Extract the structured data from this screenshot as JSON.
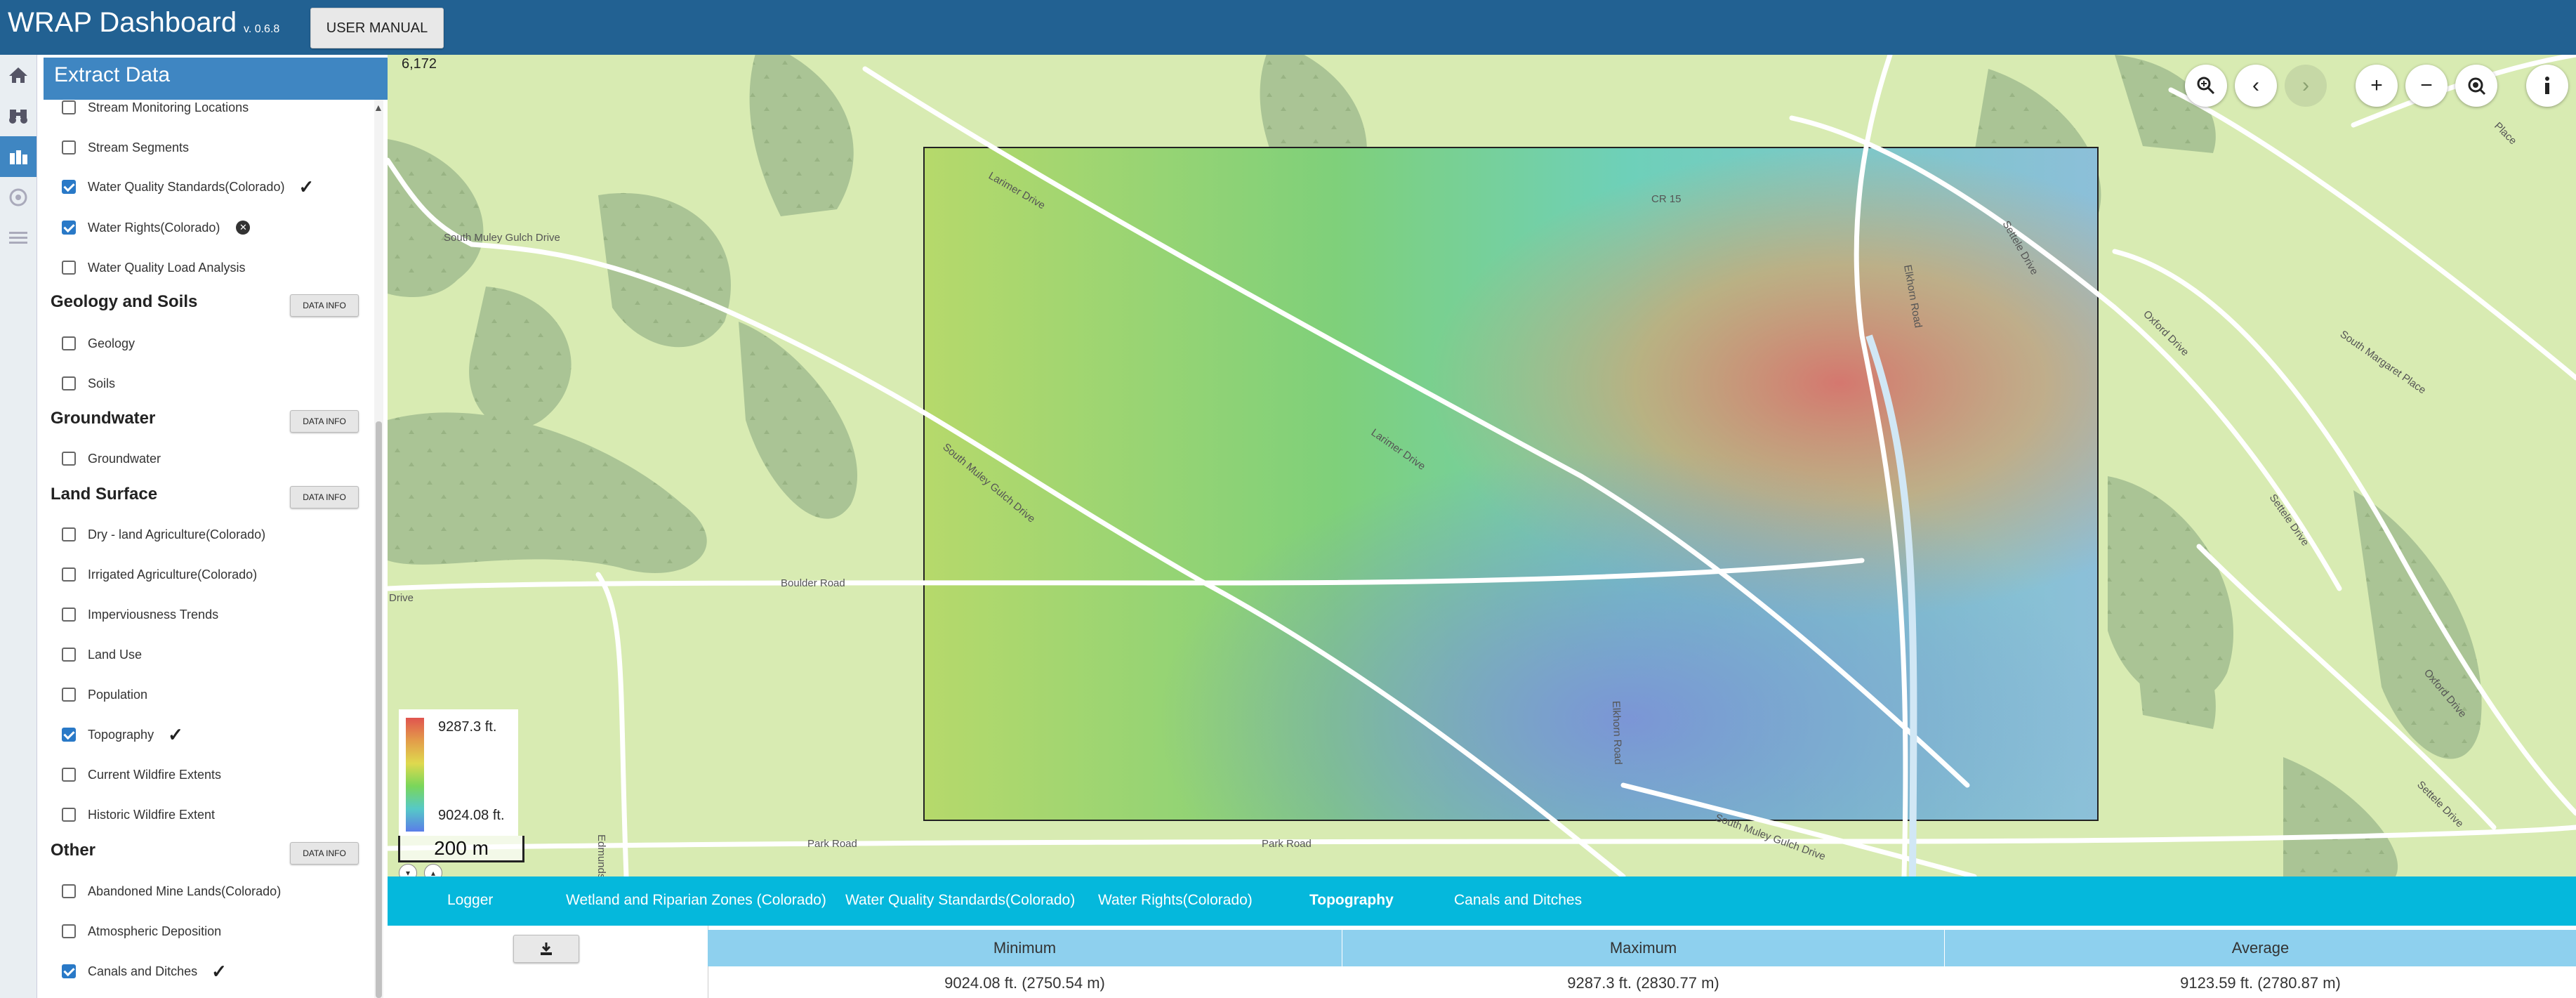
{
  "header": {
    "app_title": "WRAP Dashboard",
    "version": "v. 0.6.8",
    "manual_button": "USER MANUAL"
  },
  "rail": {
    "icons": [
      "home-icon",
      "binoculars-icon",
      "extract-data-icon",
      "target-icon",
      "list-icon"
    ],
    "active": "extract-data-icon"
  },
  "panel": {
    "title": "Extract Data",
    "items_top": [
      {
        "label": "Stream Monitoring Locations",
        "checked": false
      },
      {
        "label": "Stream Segments",
        "checked": false
      },
      {
        "label": "Water Quality Standards(Colorado)",
        "checked": true,
        "status": "done"
      },
      {
        "label": "Water Rights(Colorado)",
        "checked": true,
        "status": "error"
      },
      {
        "label": "Water Quality Load Analysis",
        "checked": false
      }
    ],
    "sections": [
      {
        "title": "Geology and Soils",
        "info": "DATA INFO",
        "items": [
          {
            "label": "Geology",
            "checked": false
          },
          {
            "label": "Soils",
            "checked": false
          }
        ]
      },
      {
        "title": "Groundwater",
        "info": "DATA INFO",
        "items": [
          {
            "label": "Groundwater",
            "checked": false
          }
        ]
      },
      {
        "title": "Land Surface",
        "info": "DATA INFO",
        "items": [
          {
            "label": "Dry - land Agriculture(Colorado)",
            "checked": false
          },
          {
            "label": "Irrigated Agriculture(Colorado)",
            "checked": false
          },
          {
            "label": "Imperviousness Trends",
            "checked": false
          },
          {
            "label": "Land Use",
            "checked": false
          },
          {
            "label": "Population",
            "checked": false
          },
          {
            "label": "Topography",
            "checked": true,
            "status": "done"
          },
          {
            "label": "Current Wildfire Extents",
            "checked": false
          },
          {
            "label": "Historic Wildfire Extent",
            "checked": false
          }
        ]
      },
      {
        "title": "Other",
        "info": "DATA INFO",
        "items": [
          {
            "label": "Abandoned Mine Lands(Colorado)",
            "checked": false
          },
          {
            "label": "Atmospheric Deposition",
            "checked": false
          },
          {
            "label": "Canals and Ditches",
            "checked": true,
            "status": "done"
          }
        ]
      }
    ]
  },
  "map": {
    "coord_readout": "6,172",
    "road_labels": [
      "Larimer Drive",
      "South Muley Gulch Drive",
      "CR 15",
      "Elkhorn Road",
      "Settele Drive",
      "Oxford Drive",
      "South Margaret Place",
      "Boulder Road",
      "Park Road",
      "Edmunds Drive",
      "Drive",
      "Place",
      "Settele Drive"
    ],
    "controls": [
      "zoom-area-icon",
      "back-icon",
      "forward-icon",
      "zoom-in-icon",
      "zoom-out-icon",
      "zoom-extent-icon",
      "info-icon"
    ],
    "legend": {
      "max": "9287.3 ft.",
      "min": "9024.08 ft."
    },
    "scale": "200 m"
  },
  "tabs": [
    {
      "label": "Logger",
      "active": false
    },
    {
      "label": "Wetland and Riparian Zones (Colorado)",
      "active": false
    },
    {
      "label": "Water Quality Standards(Colorado)",
      "active": false
    },
    {
      "label": "Water Rights(Colorado)",
      "active": false
    },
    {
      "label": "Topography",
      "active": true
    },
    {
      "label": "Canals and Ditches",
      "active": false
    }
  ],
  "table": {
    "headers": [
      "Minimum",
      "Maximum",
      "Average"
    ],
    "row": [
      "9024.08 ft. (2750.54 m)",
      "9287.3 ft. (2830.77 m)",
      "9123.59 ft. (2780.87 m)"
    ]
  },
  "colors": {
    "header": "#226192",
    "panel_header": "#3f86c2",
    "tab_bar": "#05b8dc",
    "table_header": "#8ed0ee",
    "map_bg": "#d8ebb2"
  }
}
